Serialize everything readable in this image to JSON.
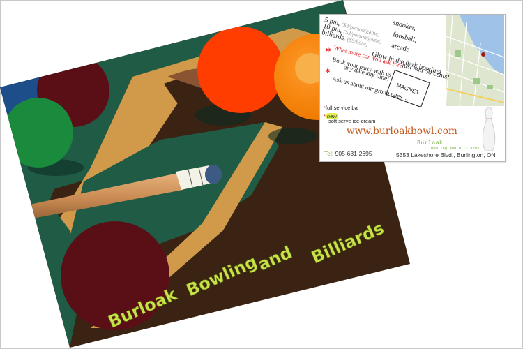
{
  "front": {
    "title_line1": "Burloak",
    "title_line2": "Bowling",
    "title_line3": "and",
    "title_line4": "Billiards"
  },
  "back": {
    "pricing": {
      "five_pin": "5 pin,",
      "five_pin_price": "($3/person/game)",
      "ten_pin": "10 pin,",
      "ten_pin_price": "($3/person/game)",
      "billiards": "billiards,",
      "billiards_price": "($9/hour)",
      "snooker": "snooker,",
      "foosball": "foosball,",
      "arcade": "arcade",
      "glow_line1": "Glow in the dark bowling",
      "glow_line2": "just add 50 cents!"
    },
    "promo": {
      "question": "What more can you ask for?",
      "party_line1": "Book your party with us",
      "party_line2": "any date any time!",
      "group_rates": "Ask us about our group rates ..."
    },
    "magnet_label": "MAGNET",
    "amenities": {
      "bar": "full service bar",
      "new_badge": "new",
      "ice_cream": "soft serve ice-cream"
    },
    "url": "www.burloakbowl.com",
    "logo": {
      "name": "Burloak",
      "tagline": "Bowling and Billiards"
    },
    "contact": {
      "tel_label": "Tel:",
      "tel": "905-631-2695",
      "address": "5353 Lakeshore Blvd., Burlington, ON"
    }
  },
  "colors": {
    "felt": "#1f5b45",
    "rail": "#d19a4a",
    "wood": "#3b2314",
    "accent_text": "#c6e34a",
    "url": "#c0541a"
  }
}
